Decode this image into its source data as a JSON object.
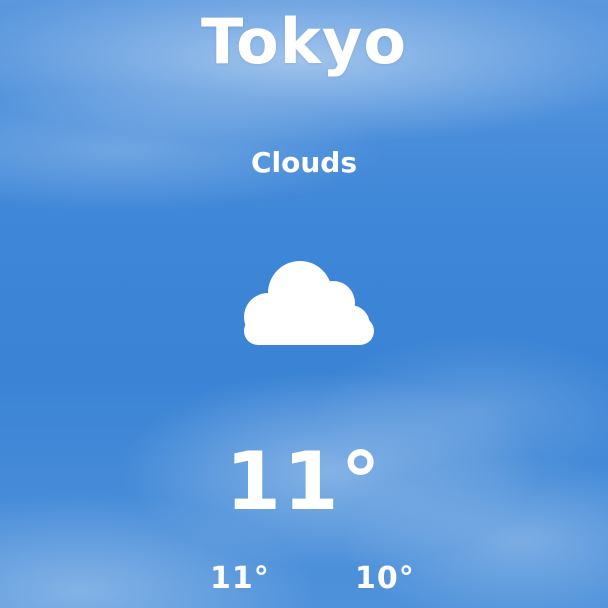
{
  "location": {
    "city": "Tokyo"
  },
  "current": {
    "condition": "Clouds",
    "icon": "cloud-icon",
    "temperature": "11°"
  },
  "range": {
    "high": "11°",
    "low": "10°"
  },
  "colors": {
    "sky": "#3f86d6",
    "text": "#ffffff",
    "icon": "#ffffff"
  }
}
